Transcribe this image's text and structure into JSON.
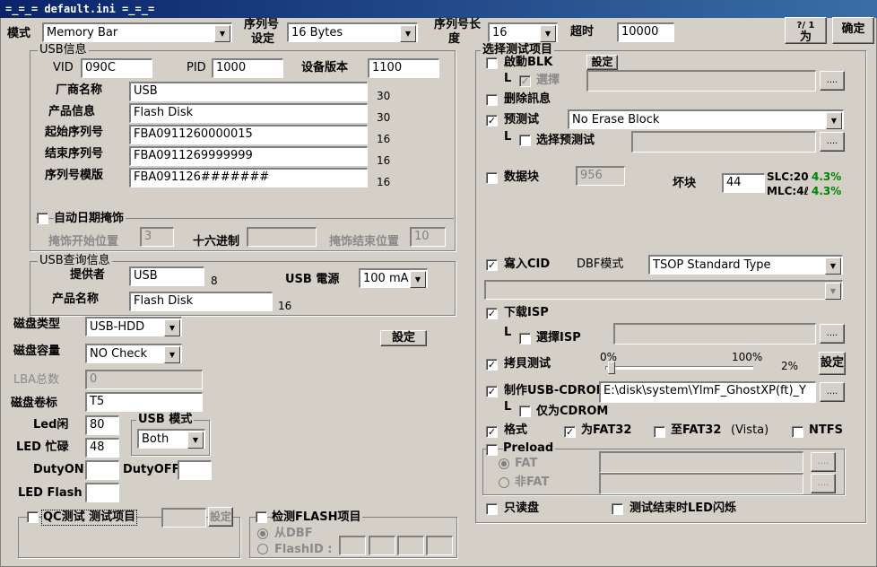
{
  "title": "=_=_=    default.ini    =_=_=",
  "top": {
    "mode_label": "模式",
    "mode_value": "Memory Bar",
    "serial_set_label_1": "序列号",
    "serial_set_label_2": "设定",
    "serial_set_value": "16 Bytes",
    "serial_len_label_1": "序列号长",
    "serial_len_label_2": "度",
    "serial_len_value": "16",
    "timeout_label": "超时",
    "timeout_value": "10000",
    "btn_partial": "为",
    "btn_partial_top": "?/ 1",
    "btn_ok": "确定"
  },
  "usb_info": {
    "group_title": "USB信息",
    "vid_label": "VID",
    "vid_value": "090C",
    "pid_label": "PID",
    "pid_value": "1000",
    "dev_ver_label": "设备版本",
    "dev_ver_value": "1100",
    "vendor_label": "厂商名称",
    "vendor_value": "USB",
    "vendor_len": "30",
    "product_label": "产品信息",
    "product_value": "Flash Disk",
    "product_len": "30",
    "start_sn_label": "起始序列号",
    "start_sn_value": "FBA0911260000015",
    "start_sn_len": "16",
    "end_sn_label": "结束序列号",
    "end_sn_value": "FBA0911269999999",
    "end_sn_len": "16",
    "sn_template_label": "序列号模版",
    "sn_template_value": "FBA091126#######",
    "sn_template_len": "16",
    "auto_date_label": "自动日期掩饰",
    "mask_start_label": "掩饰开始位置",
    "mask_start_value": "3",
    "hex_label": "十六进制",
    "hex_value": "",
    "mask_end_label": "掩饰结束位置",
    "mask_end_value": "10"
  },
  "usb_query": {
    "group_title": "USB查询信息",
    "provider_label": "提供者",
    "provider_value": "USB",
    "provider_len": "8",
    "power_label": "USB 電源",
    "power_value": "100 mA",
    "product_label": "产品名称",
    "product_value": "Flash Disk",
    "product_len": "16"
  },
  "disk": {
    "type_label": "磁盘类型",
    "type_value": "USB-HDD",
    "cap_label": "磁盘容量",
    "cap_value": "NO Check",
    "set_btn": "設定",
    "lba_label": "LBA总数",
    "lba_value": "0",
    "vol_label": "磁盘卷标",
    "vol_value": "T5",
    "led_idle_label": "Led闲",
    "led_idle_value": "80",
    "led_busy_label": "LED 忙碌",
    "led_busy_value": "48",
    "usb_mode_title": "USB 模式",
    "usb_mode_value": "Both",
    "duty_on_label": "DutyON",
    "duty_on_value": "",
    "duty_off_label": "DutyOFF",
    "duty_off_value": "",
    "led_flash_label": "LED Flash",
    "led_flash_value": ""
  },
  "qc": {
    "label": "QC测试 测试项目",
    "value": "",
    "btn": "設定"
  },
  "flash_check": {
    "label": "检测FLASH项目",
    "from_dbf": "从DBF",
    "flash_id": "FlashID :"
  },
  "tests": {
    "group_title": "选择测试项目",
    "blk_label": "啟動BLK",
    "blk_set": "設定",
    "blk_select": "選擇",
    "delete_msg": "删除訊息",
    "pretest_label": "预测试",
    "pretest_value": "No Erase Block",
    "select_pretest": "选择预测试",
    "datablock_label": "数据块",
    "datablock_value": "956",
    "badblock_label": "坏块",
    "badblock_value": "44",
    "slc_label": "SLC:20",
    "slc_pct": "4.3%",
    "mlc_label": "MLC:4ℓ",
    "mlc_pct": "4.3%",
    "write_cid": "寫入CID",
    "dbf_mode_label": "DBF模式",
    "dbf_mode_value": "TSOP Standard Type",
    "download_isp": "下载ISP",
    "select_isp": "選擇ISP",
    "copy_test": "拷貝测试",
    "slider_min": "0%",
    "slider_max": "100%",
    "slider_value": "2%",
    "copy_set": "設定",
    "slider_fraction": 0.02,
    "make_cdrom": "制作USB-CDROM",
    "cdrom_path": "E:\\disk\\system\\YlmF_GhostXP(ft)_Y",
    "cdrom_only": "仅为CDROM",
    "format": "格式",
    "fat32": "为FAT32",
    "to_fat32": "至FAT32",
    "vista": "(Vista)",
    "ntfs": "NTFS",
    "preload": "Preload",
    "fat": "FAT",
    "non_fat": "非FAT",
    "readonly": "只读盘",
    "led_blink": "测试结束时LED闪烁",
    "browse": "....",
    "l_mark": "L"
  }
}
